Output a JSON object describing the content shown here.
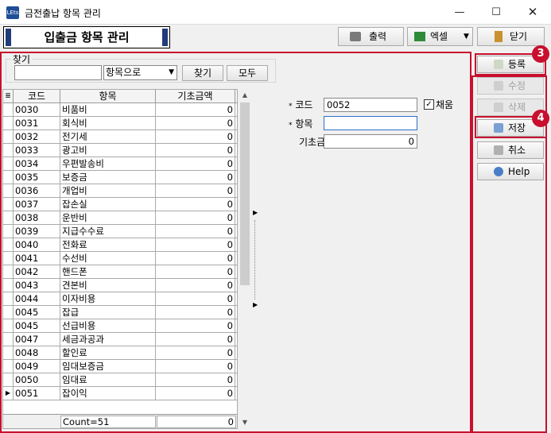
{
  "window": {
    "title": "금전출납 항목 관리",
    "app_icon_text": "LEts",
    "minimize": "—",
    "maximize": "☐",
    "close": "✕"
  },
  "header": {
    "title": "입출금 항목 관리"
  },
  "toolbar": {
    "print_label": "출력",
    "excel_label": "엑셀",
    "excel_caret": "▼",
    "close_label": "닫기"
  },
  "search": {
    "group_title": "찾기",
    "input_value": "",
    "select_value": "항목으로",
    "select_arrow": "▼",
    "find_label": "찾기",
    "all_label": "모두"
  },
  "grid": {
    "indicator_header": "≣",
    "columns": [
      "코드",
      "항목",
      "기초금액"
    ],
    "rows": [
      {
        "indicator": "",
        "code": "0030",
        "name": "비품비",
        "amount": "0"
      },
      {
        "indicator": "",
        "code": "0031",
        "name": "회식비",
        "amount": "0"
      },
      {
        "indicator": "",
        "code": "0032",
        "name": "전기세",
        "amount": "0"
      },
      {
        "indicator": "",
        "code": "0033",
        "name": "광고비",
        "amount": "0"
      },
      {
        "indicator": "",
        "code": "0034",
        "name": "우편발송비",
        "amount": "0"
      },
      {
        "indicator": "",
        "code": "0035",
        "name": "보증금",
        "amount": "0"
      },
      {
        "indicator": "",
        "code": "0036",
        "name": "개업비",
        "amount": "0"
      },
      {
        "indicator": "",
        "code": "0037",
        "name": "잡손실",
        "amount": "0"
      },
      {
        "indicator": "",
        "code": "0038",
        "name": "운반비",
        "amount": "0"
      },
      {
        "indicator": "",
        "code": "0039",
        "name": "지급수수료",
        "amount": "0"
      },
      {
        "indicator": "",
        "code": "0040",
        "name": "전화료",
        "amount": "0"
      },
      {
        "indicator": "",
        "code": "0041",
        "name": "수선비",
        "amount": "0"
      },
      {
        "indicator": "",
        "code": "0042",
        "name": "핸드폰",
        "amount": "0"
      },
      {
        "indicator": "",
        "code": "0043",
        "name": "견본비",
        "amount": "0"
      },
      {
        "indicator": "",
        "code": "0044",
        "name": "이자비용",
        "amount": "0"
      },
      {
        "indicator": "",
        "code": "0045",
        "name": "잡급",
        "amount": "0"
      },
      {
        "indicator": "",
        "code": "0045",
        "name": "선급비용",
        "amount": "0"
      },
      {
        "indicator": "",
        "code": "0047",
        "name": "세금과공과",
        "amount": "0"
      },
      {
        "indicator": "",
        "code": "0048",
        "name": "할인료",
        "amount": "0"
      },
      {
        "indicator": "",
        "code": "0049",
        "name": "임대보증금",
        "amount": "0"
      },
      {
        "indicator": "",
        "code": "0050",
        "name": "임대료",
        "amount": "0"
      },
      {
        "indicator": "▶",
        "code": "0051",
        "name": "잡이익",
        "amount": "0"
      }
    ],
    "footer_count": "Count=51",
    "footer_total": "0",
    "scroll_up": "▲",
    "scroll_down": "▼"
  },
  "splitter": {
    "top_arrow": "▶",
    "bottom_arrow": "▶"
  },
  "form": {
    "code_star": "*",
    "code_label": "코드",
    "code_value": "0052",
    "use_checked": "✓",
    "use_label": "채움",
    "name_star": "*",
    "name_label": "항목",
    "name_value": "",
    "amount_label": "기초금액",
    "amount_value": "0"
  },
  "side": {
    "register": "등록",
    "edit": "수정",
    "delete": "삭제",
    "save": "저장",
    "cancel": "취소",
    "help": "Help"
  },
  "annotations": {
    "badge3": "3",
    "badge4": "4"
  },
  "colors": {
    "highlight": "#c8102e",
    "heading_bar": "#1f3d7a"
  }
}
